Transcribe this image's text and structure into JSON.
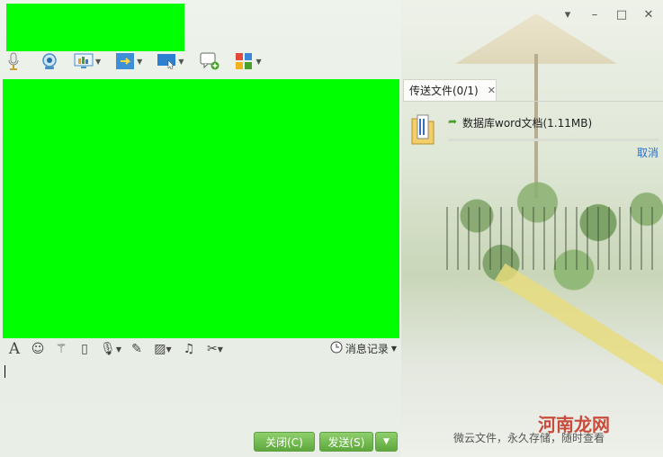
{
  "window": {
    "controls": [
      "▾",
      "–",
      "□",
      "✕"
    ]
  },
  "toolbar": {
    "items": [
      {
        "icon": "microphone-icon",
        "has_dropdown": false
      },
      {
        "icon": "webcam-icon",
        "has_dropdown": false
      },
      {
        "icon": "screen-share-icon",
        "has_dropdown": true
      },
      {
        "icon": "file-transfer-icon",
        "has_dropdown": true
      },
      {
        "icon": "remote-desktop-icon",
        "has_dropdown": true
      },
      {
        "icon": "new-chat-icon",
        "has_dropdown": false
      },
      {
        "icon": "apps-icon",
        "has_dropdown": true
      }
    ]
  },
  "input_toolbar": {
    "history_label": "消息记录"
  },
  "buttons": {
    "close_label": "关闭(C)",
    "send_label": "发送(S)"
  },
  "right_panel": {
    "tab_label": "传送文件(0/1)",
    "tab_close": "✕",
    "file_name": "数据库word文档(1.11MB)",
    "progress": 0,
    "cancel_label": "取消",
    "footer_note": "微云文件，永久存储，随时查看"
  },
  "watermark": "河南龙网",
  "colors": {
    "accent_green": "#5ea83c",
    "link_blue": "#2a6fc9",
    "placeholder_green": "#00ff00"
  }
}
